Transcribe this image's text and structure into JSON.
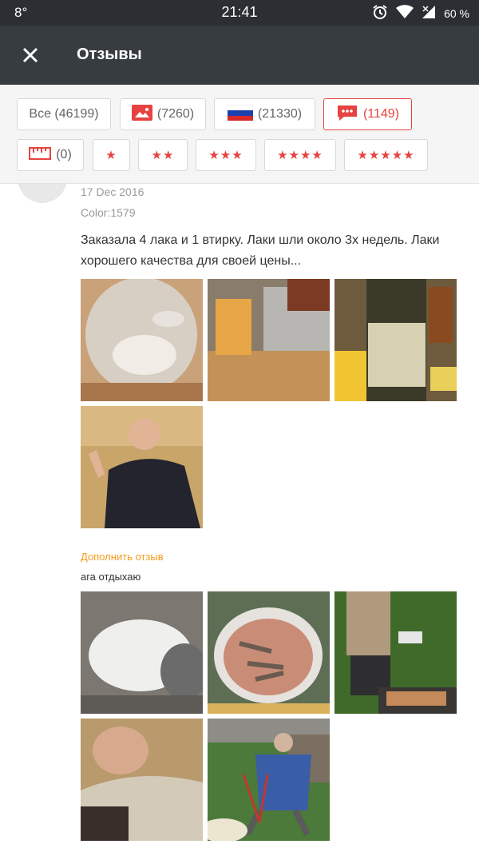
{
  "status_bar": {
    "left": "8°",
    "time": "21:41",
    "battery": "60 %"
  },
  "app_bar": {
    "title": "Отзывы"
  },
  "filters": {
    "all_label": "Все (46199)",
    "photos_count": "(7260)",
    "russia_count": "(21330)",
    "additional_count": "(1149)",
    "size_count": "(0)",
    "star1": "★",
    "star2": "★★",
    "star3": "★★★",
    "star4": "★★★★",
    "star5": "★★★★★"
  },
  "review": {
    "date": "17 Dec 2016",
    "color": "Color:1579",
    "text": "Заказала 4 лака и 1 втирку. Лаки шли около 3х недель. Лаки хорошего качества для своей цены...",
    "append_link": "Дополнить отзыв",
    "append_text": "ага отдыхаю"
  },
  "colors": {
    "accent": "#e64340",
    "header": "#373c41",
    "link": "#f59b1b"
  }
}
